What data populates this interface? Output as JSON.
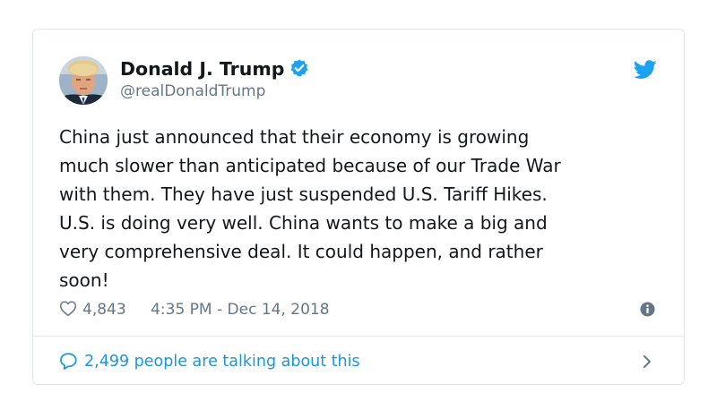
{
  "tweet": {
    "author": {
      "display_name": "Donald J. Trump",
      "handle": "@realDonaldTrump",
      "verified": true,
      "avatar_icon": "avatar-photo"
    },
    "brand_icon": "twitter-bird-icon",
    "text": "China just announced that their economy is growing\nmuch slower than anticipated because of our Trade War\nwith them. They have just suspended U.S. Tariff Hikes.\nU.S. is doing very well. China wants to make a big and\nvery comprehensive deal. It could happen, and rather\nsoon!",
    "likes": "4,843",
    "timestamp": "4:35 PM - Dec 14, 2018",
    "footer_text": "2,499 people are talking about this"
  },
  "colors": {
    "text": "#14171a",
    "muted": "#657786",
    "link": "#1b95e0",
    "verified": "#1da1f2",
    "border": "#e1e8ed"
  }
}
